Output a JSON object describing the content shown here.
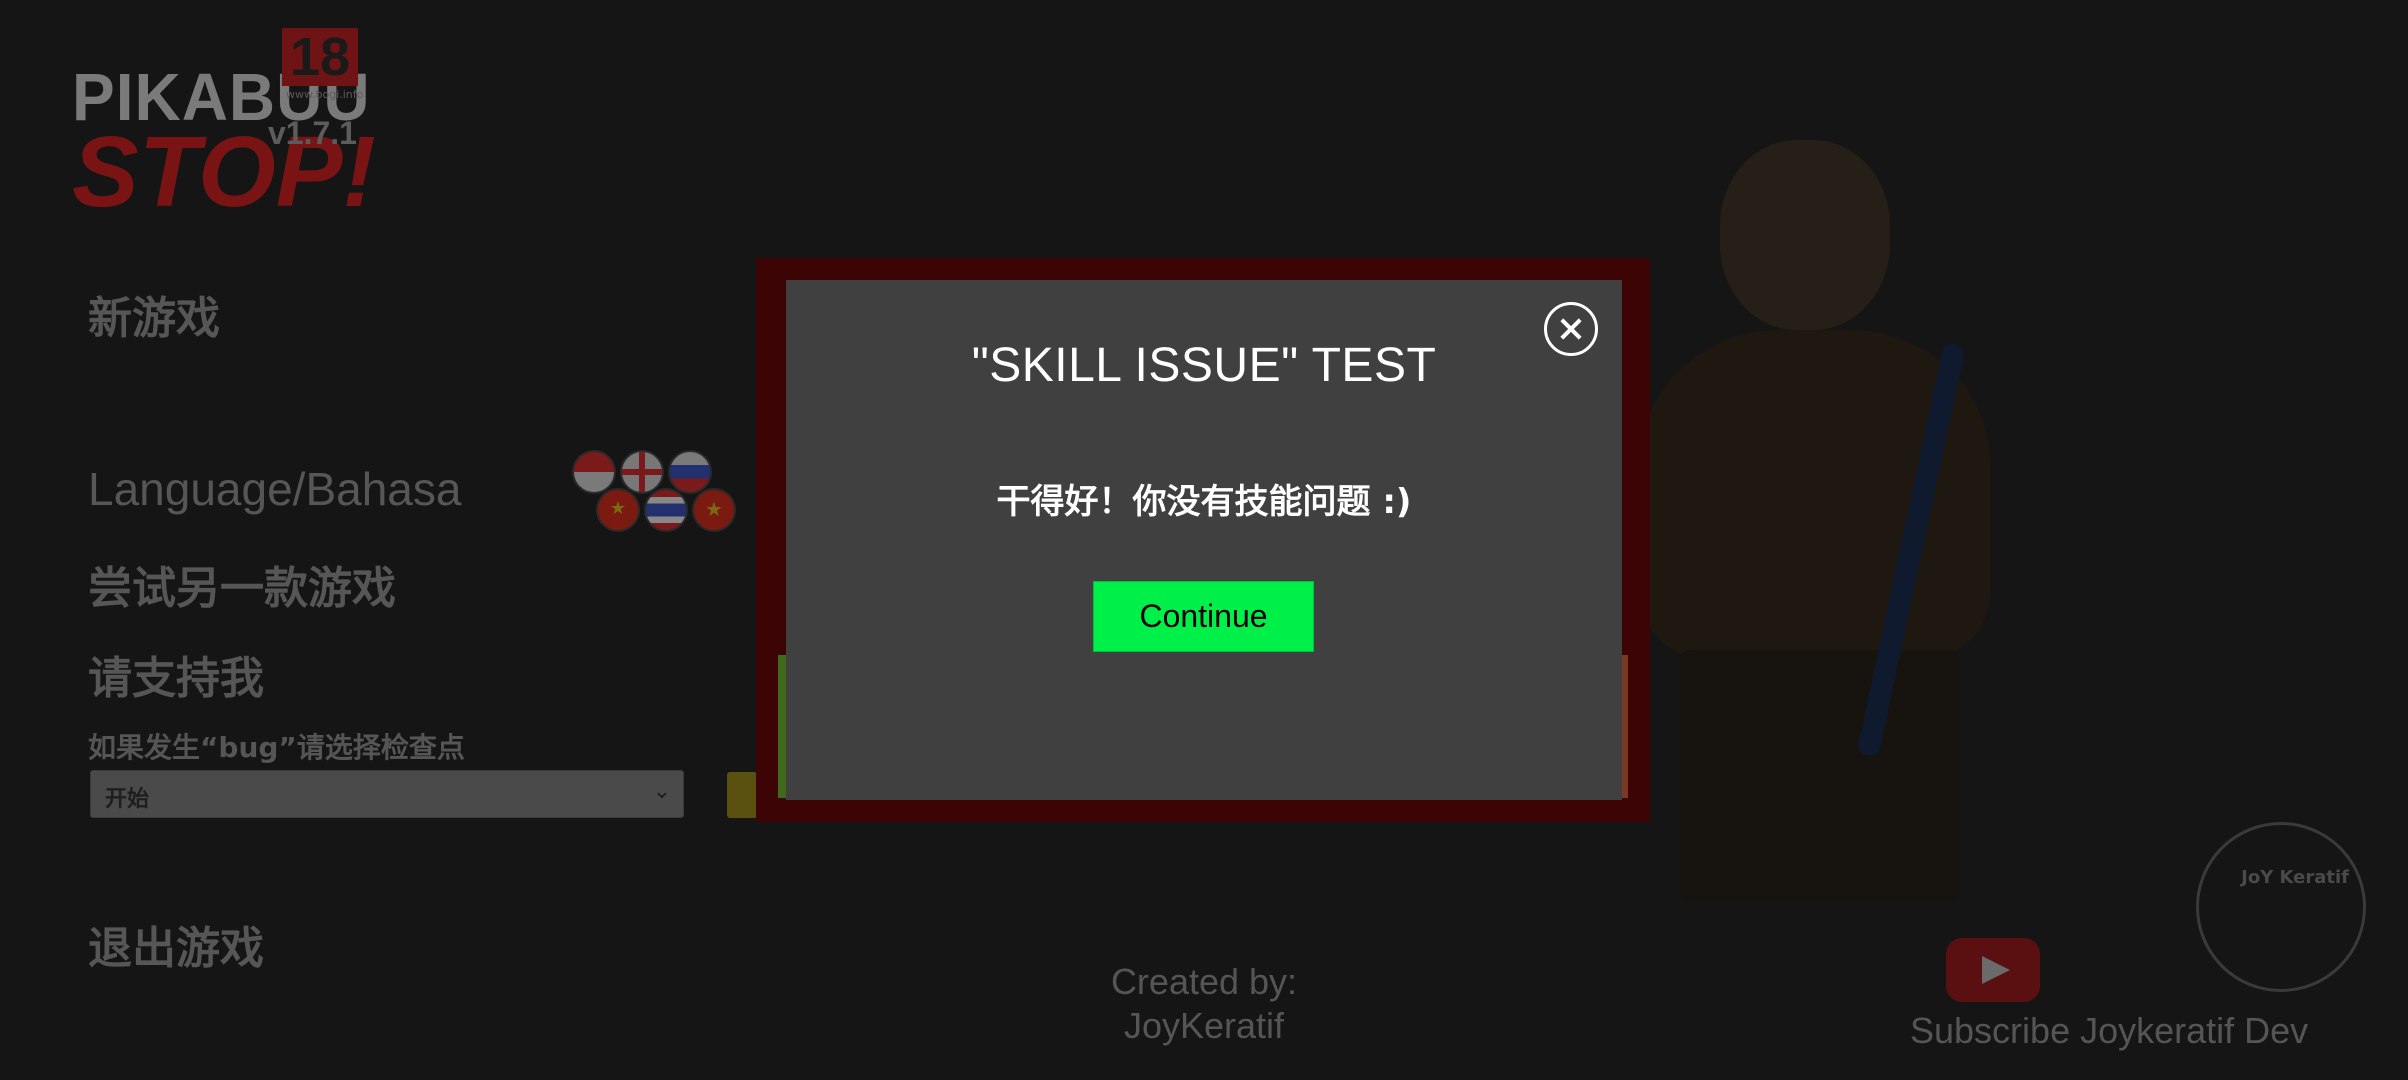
{
  "game": {
    "logo_top": "PIKABUU",
    "logo_bottom": "STOP!",
    "age_rating": "18",
    "age_site": "www.bogi.info",
    "version": "v1.7.1"
  },
  "menu": {
    "new_game": "新游戏",
    "language": "Language/Bahasa",
    "try_another": "尝试另一款游戏",
    "support": "请支持我",
    "bug_hint": "如果发生“bug”请选择检查点",
    "checkpoint_value": "开始",
    "exit": "退出游戏"
  },
  "flags": [
    "indonesia-flag",
    "uk-flag",
    "russia-flag",
    "china-flag",
    "thailand-flag",
    "vietnam-flag"
  ],
  "credits": {
    "created_by": "Created by:",
    "author": "JoyKeratif",
    "subscribe": "Subscribe Joykeratif Dev",
    "channel_logo_text": "JoY Keratif"
  },
  "modal": {
    "title": "\"SKILL ISSUE\" TEST",
    "message": "干得好！你没有技能问题 :)",
    "continue_label": "Continue"
  },
  "colors": {
    "continue_button": "#00f04a",
    "modal_background": "#404040",
    "modal_frame": "#3c0404"
  }
}
